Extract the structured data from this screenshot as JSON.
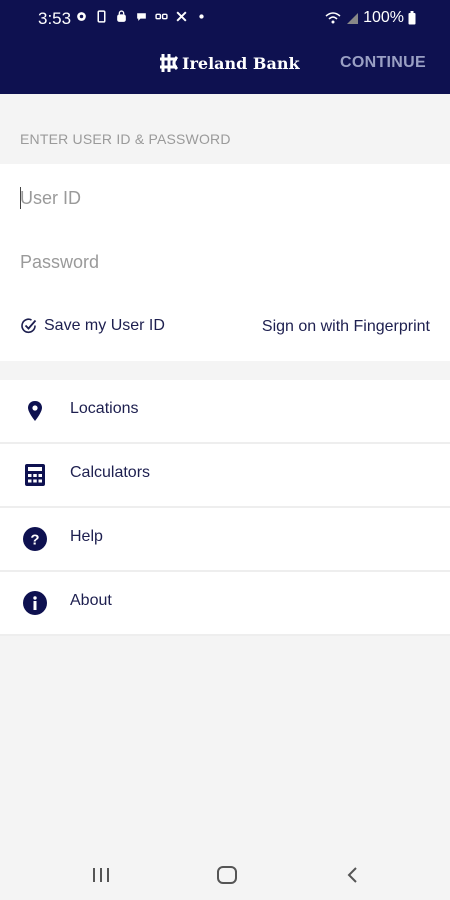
{
  "status_bar": {
    "time": "3:53",
    "battery": "100%",
    "icons_left": [
      "gear-icon",
      "phone-icon",
      "bag-icon",
      "message-icon",
      "link-icon",
      "x-icon",
      "dot-icon"
    ],
    "icons_right": [
      "wifi-icon",
      "signal-icon",
      "battery-icon"
    ]
  },
  "app_bar": {
    "brand": "Ireland Bank",
    "continue_label": "CONTINUE"
  },
  "login": {
    "section_label": "ENTER USER ID & PASSWORD",
    "user_id_placeholder": "User ID",
    "password_placeholder": "Password",
    "save_user_id_label": "Save my User ID",
    "fingerprint_label": "Sign on with Fingerprint"
  },
  "menu": {
    "items": [
      {
        "label": "Locations",
        "icon": "location-pin-icon"
      },
      {
        "label": "Calculators",
        "icon": "calculator-icon"
      },
      {
        "label": "Help",
        "icon": "question-icon"
      },
      {
        "label": "About",
        "icon": "info-icon"
      }
    ]
  },
  "nav": {
    "buttons": [
      "recent-apps-icon",
      "home-icon",
      "back-icon"
    ]
  },
  "colors": {
    "brand_navy": "#0e1150",
    "accent": "#1d1f4f",
    "continue_disabled": "#9aa0c4"
  }
}
